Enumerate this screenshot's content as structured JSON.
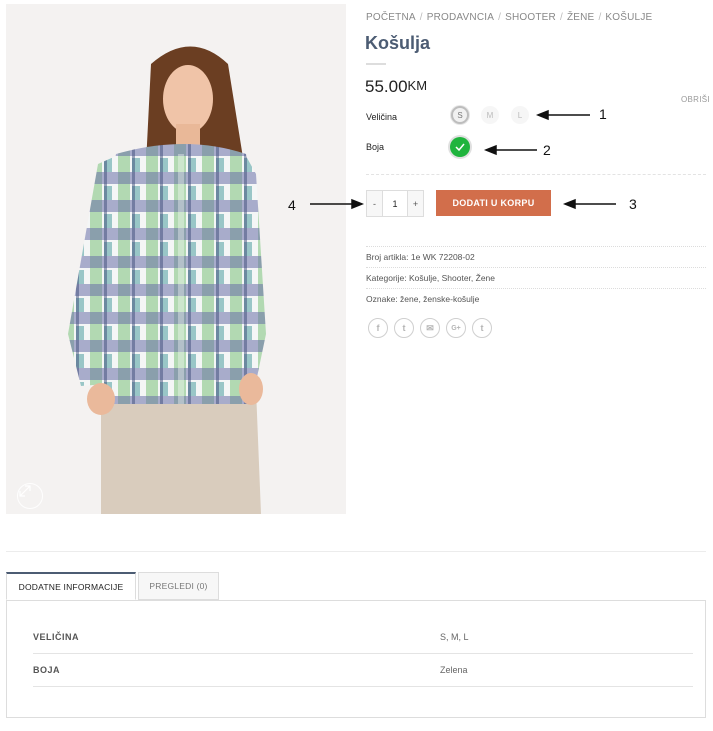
{
  "breadcrumb": {
    "items": [
      "POČETNA",
      "PRODAVNCIA",
      "SHOOTER",
      "ŽENE",
      "KOŠULJE"
    ],
    "separator": "/"
  },
  "product": {
    "title": "Košulja",
    "price": "55.00",
    "currency": "KM",
    "clear_label": "OBRIŠI",
    "size_label": "Veličina",
    "sizes": [
      "S",
      "M",
      "L"
    ],
    "selected_size": "S",
    "color_label": "Boja",
    "selected_color": "#1fb43d",
    "quantity": "1",
    "minus": "-",
    "plus": "+",
    "add_to_cart": "DODATI U KORPU"
  },
  "meta": {
    "sku_label": "Broj artikla:",
    "sku_value": "1e WK 72208-02",
    "categories_label": "Kategorije:",
    "categories_value": "Košulje, Shooter, Žene",
    "tags_label": "Oznake:",
    "tags_value": "žene, ženske-košulje"
  },
  "share_icons": [
    "facebook-icon",
    "twitter-icon",
    "email-icon",
    "google-plus-icon",
    "tumblr-icon"
  ],
  "share_glyphs": [
    "f",
    "t",
    "✉",
    "G+",
    "t"
  ],
  "annotations": [
    "1",
    "2",
    "3",
    "4"
  ],
  "tabs": [
    {
      "label": "DODATNE INFORMACIJE",
      "active": true
    },
    {
      "label": "PREGLEDI (0)",
      "active": false
    }
  ],
  "additional_info": [
    {
      "label": "VELIČINA",
      "value": "S, M, L"
    },
    {
      "label": "BOJA",
      "value": "Zelena"
    }
  ],
  "colors": {
    "accent": "#d26e4b",
    "title": "#4c5c73",
    "swatch_green": "#1fb43d"
  }
}
